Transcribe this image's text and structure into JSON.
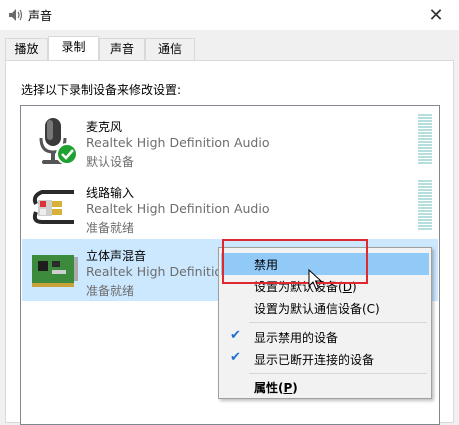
{
  "window": {
    "title": "声音",
    "close_glyph": "✕"
  },
  "tabs": [
    {
      "label": "播放"
    },
    {
      "label": "录制"
    },
    {
      "label": "声音"
    },
    {
      "label": "通信"
    }
  ],
  "instruction": "选择以下录制设备来修改设置:",
  "devices": [
    {
      "name": "麦克风",
      "driver": "Realtek High Definition Audio",
      "status": "默认设备",
      "icon": "microphone-icon",
      "selected": false
    },
    {
      "name": "线路输入",
      "driver": "Realtek High Definition Audio",
      "status": "准备就绪",
      "icon": "line-in-cable-icon",
      "selected": false
    },
    {
      "name": "立体声混音",
      "driver": "Realtek High Definition",
      "status": "准备就绪",
      "icon": "sound-card-icon",
      "selected": true
    }
  ],
  "context_menu": {
    "items": [
      {
        "label": "禁用",
        "hover": true
      },
      {
        "label_main": "设置为默认设备(",
        "label_key": "D",
        "label_end": ")"
      },
      {
        "label": "设置为默认通信设备(C)"
      },
      {
        "label": "显示禁用的设备",
        "checked": true
      },
      {
        "label": "显示已断开连接的设备",
        "checked": true
      },
      {
        "label_main": "属性(",
        "label_key": "P",
        "label_end": ")",
        "bold": true
      }
    ]
  },
  "colors": {
    "selection": "#cce8ff",
    "menu_hover": "#91c9f7",
    "highlight_box": "#e0292f",
    "check": "#1e6fd0"
  }
}
